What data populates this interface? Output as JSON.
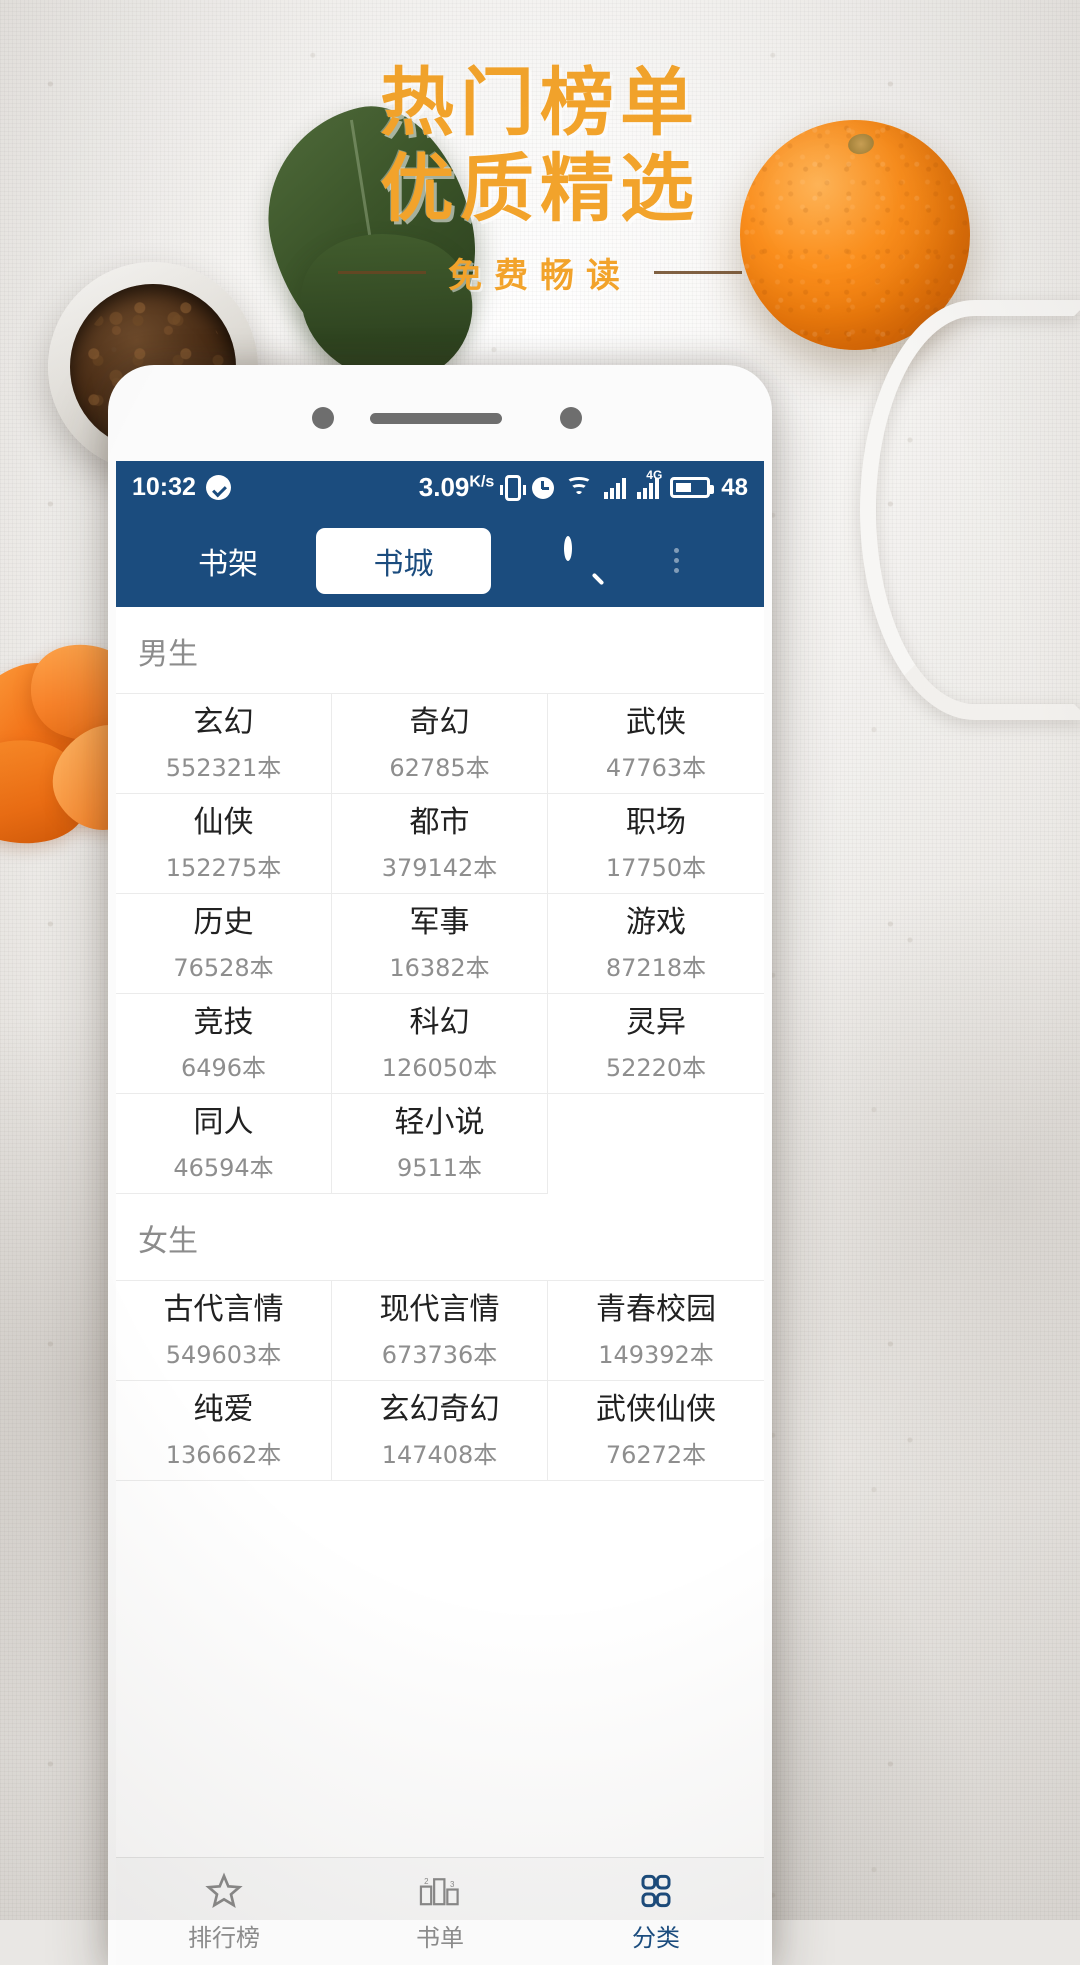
{
  "poster": {
    "headline_line1": "热门榜单",
    "headline_line2": "优质精选",
    "subtitle": "免费畅读",
    "accent_color": "#f2a32b",
    "rule_color": "#6a4522"
  },
  "phone": {
    "statusbar": {
      "time": "10:32",
      "check_icon": "check-circle-icon",
      "net_speed": "3.09",
      "net_speed_unit": "K/s",
      "vibrate_icon": "vibrate-icon",
      "alarm_icon": "alarm-icon",
      "wifi_icon": "wifi-icon",
      "signal_icon": "signal-bars-icon",
      "signal2_icon": "signal-bars-4g-icon",
      "signal2_badge": "4G",
      "battery_icon": "battery-icon",
      "battery_level": "48",
      "bg_color": "#1b4c7e"
    },
    "navbar": {
      "tab_shelf": "书架",
      "tab_store": "书城",
      "active_tab": "书城",
      "search_icon": "search-icon",
      "more_icon": "more-dots-icon"
    },
    "sections": [
      {
        "title": "男生",
        "items": [
          {
            "name": "玄幻",
            "count": "552321本"
          },
          {
            "name": "奇幻",
            "count": "62785本"
          },
          {
            "name": "武侠",
            "count": "47763本"
          },
          {
            "name": "仙侠",
            "count": "152275本"
          },
          {
            "name": "都市",
            "count": "379142本"
          },
          {
            "name": "职场",
            "count": "17750本"
          },
          {
            "name": "历史",
            "count": "76528本"
          },
          {
            "name": "军事",
            "count": "16382本"
          },
          {
            "name": "游戏",
            "count": "87218本"
          },
          {
            "name": "竞技",
            "count": "6496本"
          },
          {
            "name": "科幻",
            "count": "126050本"
          },
          {
            "name": "灵异",
            "count": "52220本"
          },
          {
            "name": "同人",
            "count": "46594本"
          },
          {
            "name": "轻小说",
            "count": "9511本"
          },
          {
            "name": "",
            "count": ""
          }
        ]
      },
      {
        "title": "女生",
        "items": [
          {
            "name": "古代言情",
            "count": "549603本"
          },
          {
            "name": "现代言情",
            "count": "673736本"
          },
          {
            "name": "青春校园",
            "count": "149392本"
          },
          {
            "name": "纯爱",
            "count": "136662本"
          },
          {
            "name": "玄幻奇幻",
            "count": "147408本"
          },
          {
            "name": "武侠仙侠",
            "count": "76272本"
          }
        ]
      }
    ],
    "tabbar": {
      "items": [
        {
          "label": "排行榜",
          "icon": "star-icon",
          "active": false
        },
        {
          "label": "书单",
          "icon": "ranking-icon",
          "active": false
        },
        {
          "label": "分类",
          "icon": "grid-icon",
          "active": true
        }
      ],
      "active_color": "#1b4c7e",
      "inactive_color": "#8b8b8b"
    }
  }
}
